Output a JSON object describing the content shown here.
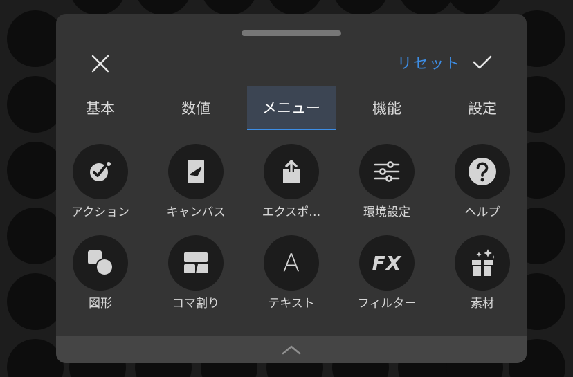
{
  "header": {
    "reset_label": "リセット",
    "close_icon": "close-icon",
    "confirm_icon": "checkmark-icon",
    "accent_color": "#3d8ee6"
  },
  "tabs": [
    {
      "label": "基本",
      "active": false
    },
    {
      "label": "数値",
      "active": false
    },
    {
      "label": "メニュー",
      "active": true
    },
    {
      "label": "機能",
      "active": false
    },
    {
      "label": "設定",
      "active": false
    }
  ],
  "items": [
    {
      "label": "アクション",
      "icon": "action-wrench-icon"
    },
    {
      "label": "キャンバス",
      "icon": "canvas-icon"
    },
    {
      "label": "エクスポ…",
      "icon": "export-share-icon"
    },
    {
      "label": "環境設定",
      "icon": "sliders-icon"
    },
    {
      "label": "ヘルプ",
      "icon": "help-icon"
    },
    {
      "label": "図形",
      "icon": "shapes-icon"
    },
    {
      "label": "コマ割り",
      "icon": "panel-layout-icon"
    },
    {
      "label": "テキスト",
      "icon": "text-icon"
    },
    {
      "label": "フィルター",
      "icon": "filter-fx-icon"
    },
    {
      "label": "素材",
      "icon": "materials-gift-icon"
    }
  ],
  "filter_icon_text": "FX",
  "text_icon_glyph": "A",
  "footer": {
    "icon": "chevron-up-icon"
  }
}
